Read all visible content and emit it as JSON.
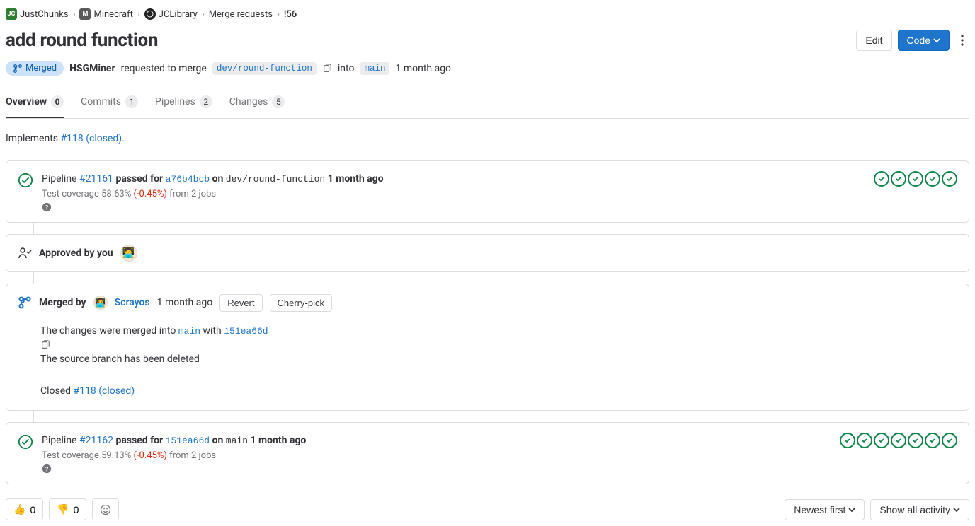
{
  "breadcrumbs": {
    "group": "JustChunks",
    "project": "Minecraft",
    "subproject": "JCLibrary",
    "section": "Merge requests",
    "ref": "!56"
  },
  "title": "add round function",
  "actions": {
    "edit": "Edit",
    "code": "Code"
  },
  "status": {
    "state": "Merged",
    "author": "HSGMiner",
    "requested": "requested to merge",
    "source_branch": "dev/round-function",
    "into": "into",
    "target_branch": "main",
    "time": "1 month ago"
  },
  "tabs": {
    "overview": {
      "label": "Overview",
      "count": "0"
    },
    "commits": {
      "label": "Commits",
      "count": "1"
    },
    "pipelines": {
      "label": "Pipelines",
      "count": "2"
    },
    "changes": {
      "label": "Changes",
      "count": "5"
    }
  },
  "description": {
    "prefix": "Implements ",
    "issue": "#118 (closed)",
    "suffix": "."
  },
  "pipeline1": {
    "label": "Pipeline",
    "id": "#21161",
    "passed": "passed",
    "for": "for",
    "sha": "a76b4bcb",
    "on": "on",
    "branch": "dev/round-function",
    "time": "1 month ago",
    "cov_pre": "Test coverage 58.63%",
    "cov_delta": "(-0.45%)",
    "cov_post": " from 2 jobs"
  },
  "approval": {
    "text": "Approved by you"
  },
  "merged": {
    "by": "Merged by",
    "user": "Scrayos",
    "time": "1 month ago",
    "revert": "Revert",
    "cherry": "Cherry-pick",
    "line1_pre": "The changes were merged into ",
    "line1_branch": "main",
    "line1_mid": " with ",
    "line1_sha": "151ea66d",
    "line2": "The source branch has been deleted",
    "line3_pre": "Closed ",
    "line3_issue": "#118 (closed)"
  },
  "pipeline2": {
    "label": "Pipeline",
    "id": "#21162",
    "passed": "passed",
    "for": "for",
    "sha": "151ea66d",
    "on": "on",
    "branch": "main",
    "time": "1 month ago",
    "cov_pre": "Test coverage 59.13%",
    "cov_delta": "(-0.45%)",
    "cov_post": " from 2 jobs"
  },
  "reactions": {
    "thumbup": "0",
    "thumbdown": "0"
  },
  "sort": {
    "newest": "Newest first",
    "activity": "Show all activity"
  }
}
